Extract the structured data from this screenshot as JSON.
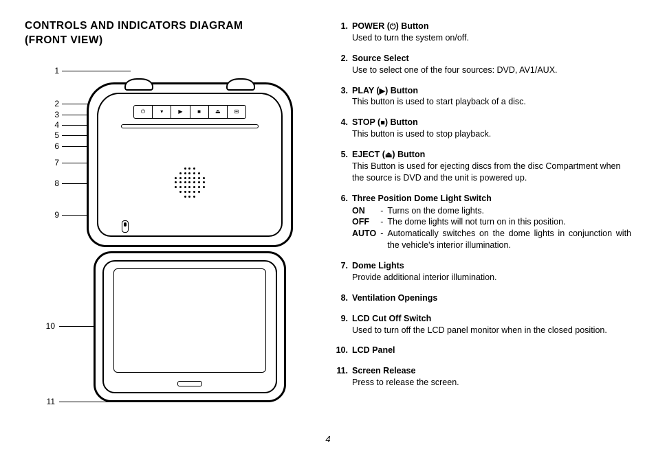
{
  "title_line1": "CONTROLS AND INDICATORS DIAGRAM",
  "title_line2": "(FRONT VIEW)",
  "page_number": "4",
  "diagram_labels": [
    "1",
    "2",
    "3",
    "4",
    "5",
    "6",
    "7",
    "8",
    "9",
    "10",
    "11"
  ],
  "items": [
    {
      "num": "1.",
      "title_pre": "POWER (",
      "icon": "⏻",
      "title_post": ") Button",
      "desc": "Used to turn the system on/off."
    },
    {
      "num": "2.",
      "title": "Source Select",
      "desc": "Use to select one of the four sources: DVD, AV1/AUX."
    },
    {
      "num": "3.",
      "title_pre": "PLAY (",
      "icon": "▶",
      "title_post": ") Button",
      "desc": "This button is used to start playback of a disc."
    },
    {
      "num": "4.",
      "title_pre": "STOP (",
      "icon": "■",
      "title_post": ") Button",
      "desc": "This button is used to stop playback."
    },
    {
      "num": "5.",
      "title_pre": "EJECT (",
      "icon": "⏏",
      "title_post": ") Button",
      "desc": "This Button is used for ejecting discs from the disc Compartment when the source is DVD and the unit is powered up."
    },
    {
      "num": "6.",
      "title": "Three Position Dome Light Switch",
      "sub": [
        {
          "key": "ON",
          "val": "Turns on the dome lights."
        },
        {
          "key": "OFF",
          "val": "The dome lights will not turn on in this position."
        },
        {
          "key": "AUTO",
          "val": "Automatically switches on the dome lights in conjunction with the vehicle's interior illumination."
        }
      ]
    },
    {
      "num": "7.",
      "title": "Dome Lights",
      "desc": "Provide additional interior illumination."
    },
    {
      "num": "8.",
      "title": "Ventilation Openings"
    },
    {
      "num": "9.",
      "title": "LCD Cut Off Switch",
      "desc": "Used to turn off the LCD panel monitor when in the closed position."
    },
    {
      "num": "10.",
      "title": "LCD Panel"
    },
    {
      "num": "11.",
      "title": "Screen Release",
      "desc": "Press to release the screen."
    }
  ]
}
